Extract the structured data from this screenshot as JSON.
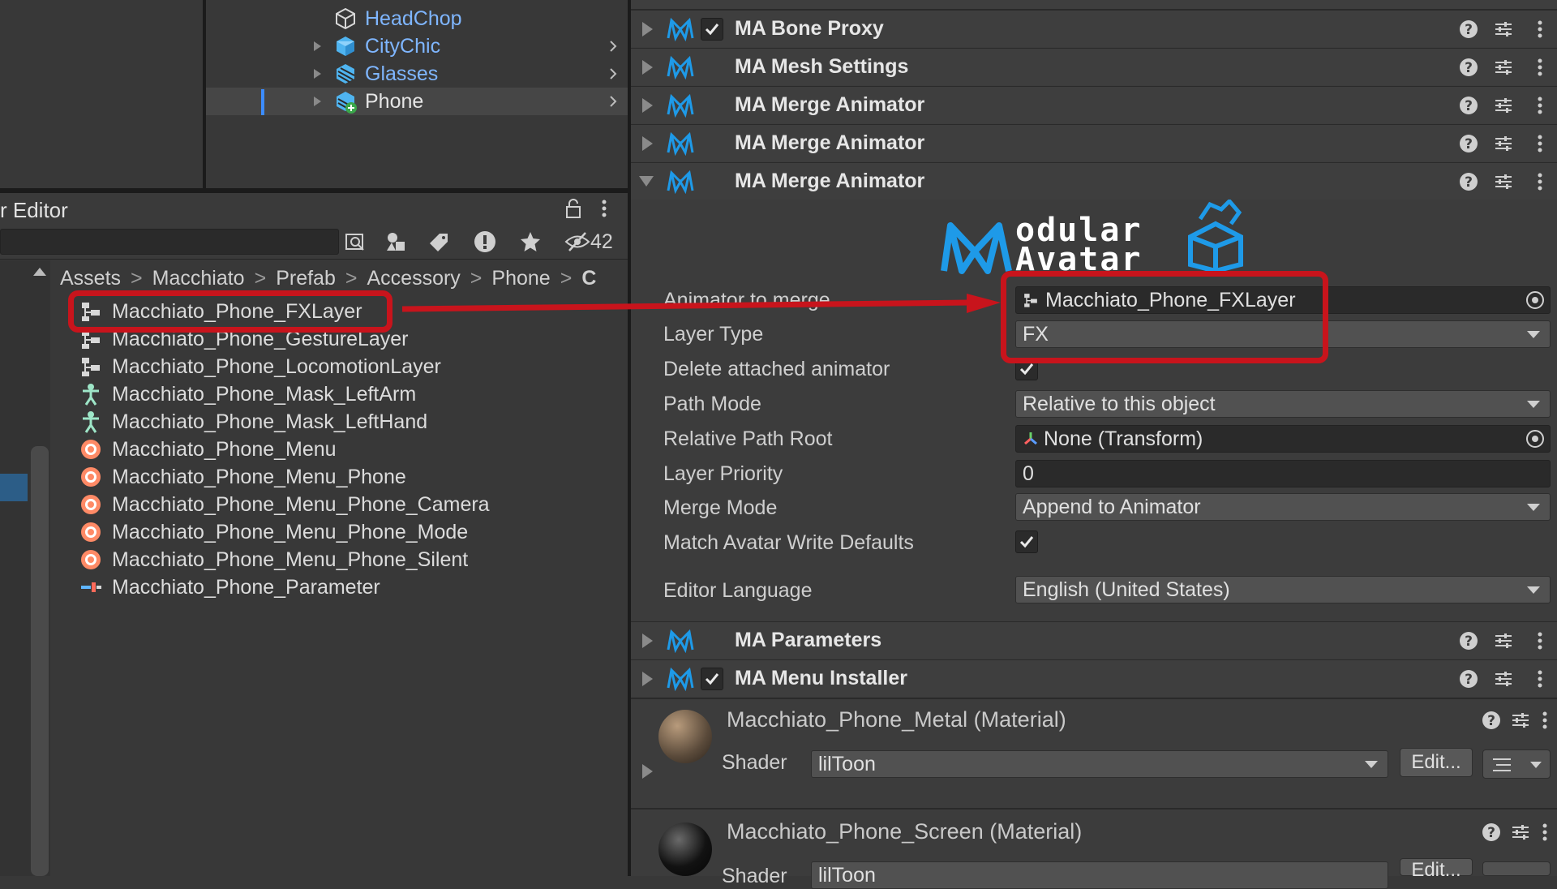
{
  "hierarchy": {
    "items": [
      {
        "label": "HeadChop",
        "expandable": false,
        "selected": false
      },
      {
        "label": "CityChic",
        "expandable": true,
        "selected": false
      },
      {
        "label": "Glasses",
        "expandable": true,
        "selected": false
      },
      {
        "label": "Phone",
        "expandable": true,
        "selected": true
      }
    ]
  },
  "project": {
    "title": "r Editor",
    "hidden_count": "42",
    "breadcrumbs": [
      "Assets",
      "Macchiato",
      "Prefab",
      "Accessory",
      "Phone",
      "C"
    ],
    "files": [
      {
        "name": "Macchiato_Phone_FXLayer",
        "icon": "animator-controller-icon"
      },
      {
        "name": "Macchiato_Phone_GestureLayer",
        "icon": "animator-controller-icon"
      },
      {
        "name": "Macchiato_Phone_LocomotionLayer",
        "icon": "animator-controller-icon"
      },
      {
        "name": "Macchiato_Phone_Mask_LeftArm",
        "icon": "avatar-mask-icon"
      },
      {
        "name": "Macchiato_Phone_Mask_LeftHand",
        "icon": "avatar-mask-icon"
      },
      {
        "name": "Macchiato_Phone_Menu",
        "icon": "expressions-menu-icon"
      },
      {
        "name": "Macchiato_Phone_Menu_Phone",
        "icon": "expressions-menu-icon"
      },
      {
        "name": "Macchiato_Phone_Menu_Phone_Camera",
        "icon": "expressions-menu-icon"
      },
      {
        "name": "Macchiato_Phone_Menu_Phone_Mode",
        "icon": "expressions-menu-icon"
      },
      {
        "name": "Macchiato_Phone_Menu_Phone_Silent",
        "icon": "expressions-menu-icon"
      },
      {
        "name": "Macchiato_Phone_Parameter",
        "icon": "parameters-icon"
      }
    ]
  },
  "inspector": {
    "components": [
      {
        "title": "MA Bone Proxy",
        "checkbox": true
      },
      {
        "title": "MA Mesh Settings",
        "checkbox": false
      },
      {
        "title": "MA Merge Animator",
        "checkbox": false
      },
      {
        "title": "MA Merge Animator",
        "checkbox": false
      },
      {
        "title": "MA Merge Animator",
        "checkbox": false,
        "expanded": true
      }
    ],
    "logo_text": "odular Avatar",
    "properties": {
      "animator_label": "Animator to merge",
      "animator_value": "Macchiato_Phone_FXLayer",
      "layer_type_label": "Layer Type",
      "layer_type_value": "FX",
      "delete_label": "Delete attached animator",
      "delete_checked": true,
      "path_mode_label": "Path Mode",
      "path_mode_value": "Relative to this object",
      "path_root_label": "Relative Path Root",
      "path_root_value": "None (Transform)",
      "priority_label": "Layer Priority",
      "priority_value": "0",
      "merge_mode_label": "Merge Mode",
      "merge_mode_value": "Append to Animator",
      "match_wd_label": "Match Avatar Write Defaults",
      "match_wd_checked": true,
      "editor_lang_label": "Editor Language",
      "editor_lang_value": "English (United States)"
    },
    "after_components": [
      {
        "title": "MA Parameters",
        "checkbox": false
      },
      {
        "title": "MA Menu Installer",
        "checkbox": true
      }
    ],
    "materials": [
      {
        "title": "Macchiato_Phone_Metal (Material)",
        "shader_label": "Shader",
        "shader": "lilToon",
        "edit": "Edit..."
      },
      {
        "title": "Macchiato_Phone_Screen (Material)",
        "shader_label": "Shader",
        "shader": "lilToon",
        "edit": "Edit..."
      }
    ]
  },
  "colors": {
    "annotation_red": "#c8141c",
    "link_blue": "#7fb6ff",
    "ma_icon_blue": "#1e9ae8"
  }
}
